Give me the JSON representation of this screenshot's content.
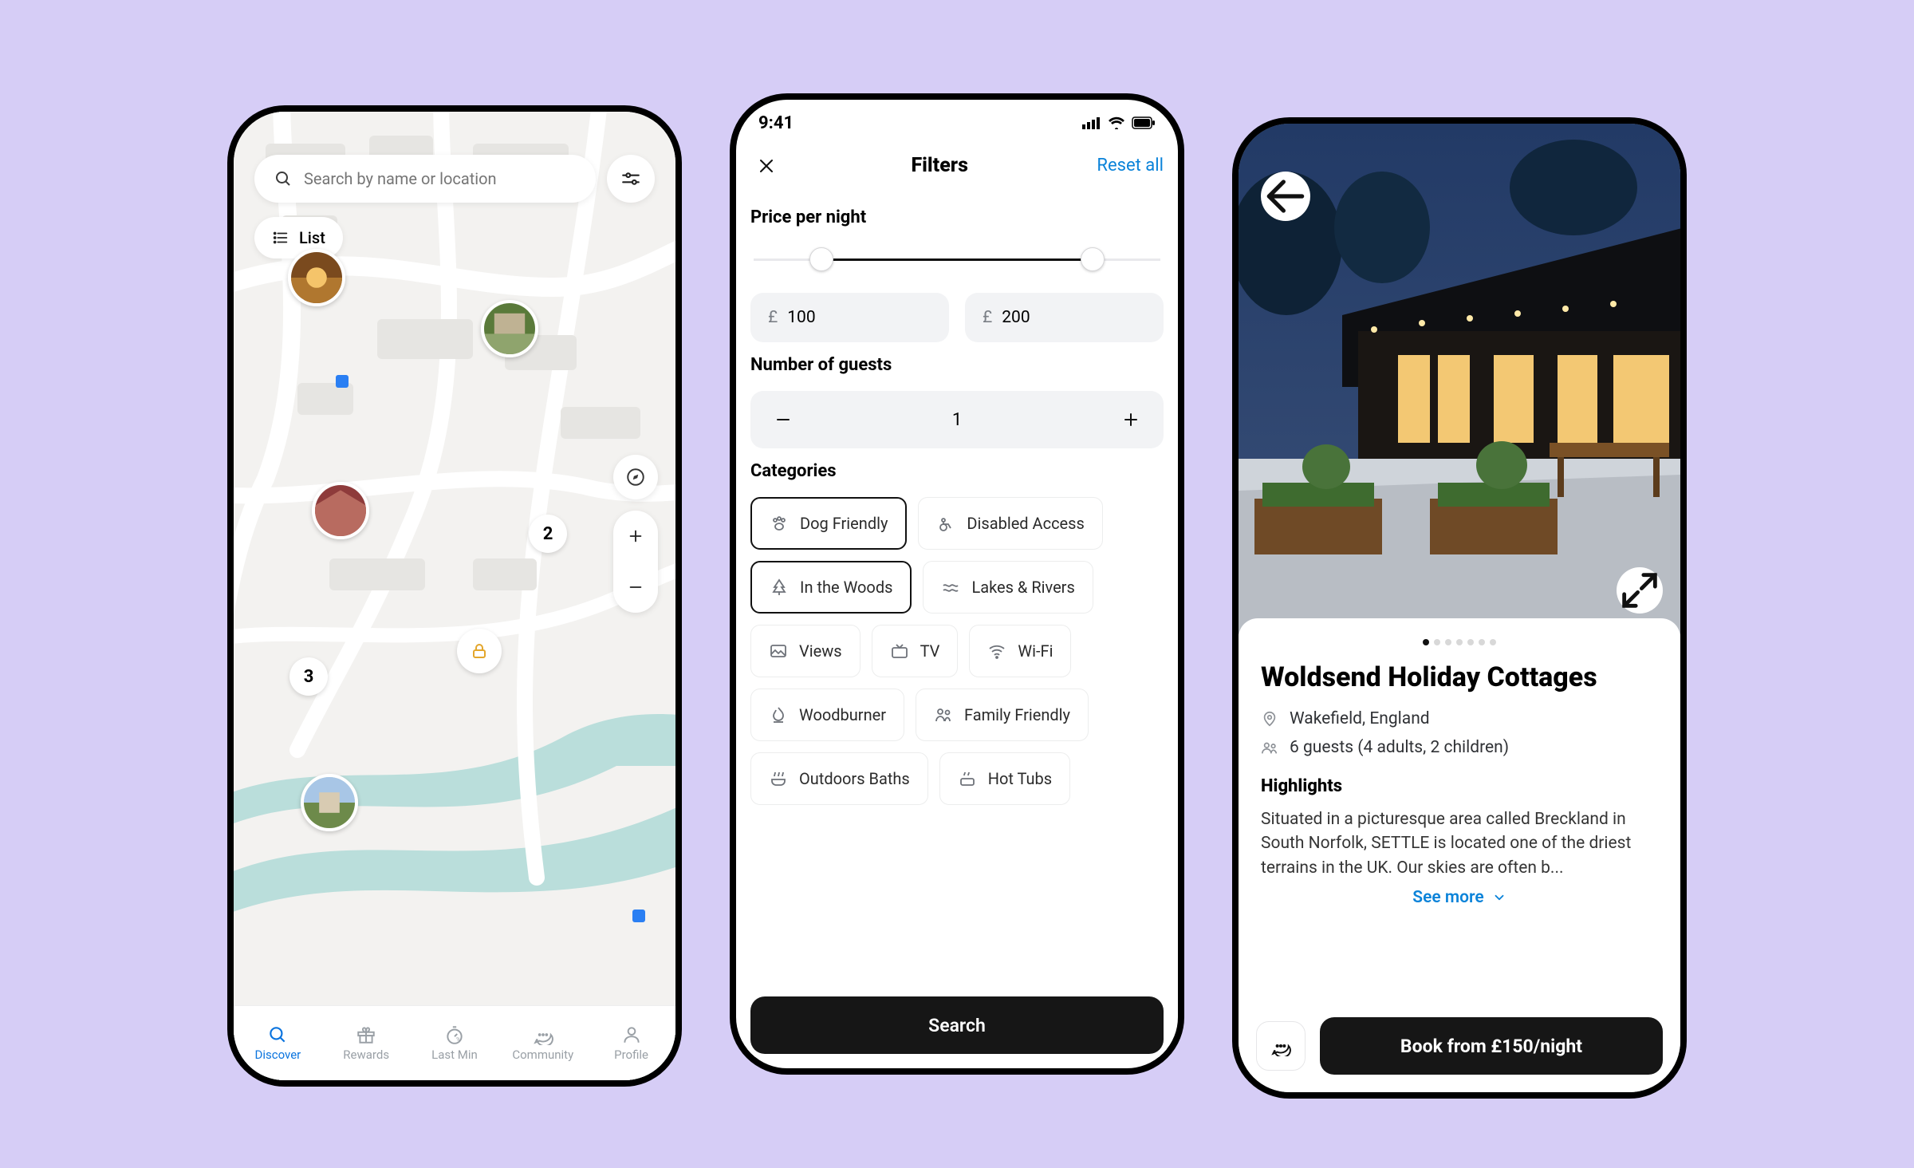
{
  "map": {
    "search_placeholder": "Search by name or location",
    "list_label": "List",
    "clusters": {
      "a": "2",
      "b": "3"
    },
    "tabs": {
      "discover": "Discover",
      "rewards": "Rewards",
      "lastmin": "Last Min",
      "community": "Community",
      "profile": "Profile"
    }
  },
  "filters": {
    "status_time": "9:41",
    "title": "Filters",
    "reset_label": "Reset all",
    "price_label": "Price per night",
    "currency": "£",
    "price_min": "100",
    "price_max": "200",
    "guests_label": "Number of guests",
    "guest_count": "1",
    "categories_label": "Categories",
    "cats": {
      "dog": "Dog Friendly",
      "disabled": "Disabled Access",
      "woods": "In the Woods",
      "lakes": "Lakes & Rivers",
      "views": "Views",
      "tv": "TV",
      "wifi": "Wi-Fi",
      "wood": "Woodburner",
      "family": "Family Friendly",
      "baths": "Outdoors Baths",
      "hottubs": "Hot Tubs"
    },
    "search_label": "Search"
  },
  "detail": {
    "title": "Woldsend Holiday Cottages",
    "location": "Wakefield, England",
    "guests": "6 guests (4 adults, 2 children)",
    "highlights_label": "Highlights",
    "highlights_text": "Situated in a picturesque area called Breckland in South Norfolk, SETTLE is located one of the driest terrains in the UK. Our skies are often b...",
    "see_more": "See more",
    "book_label": "Book from £150/night"
  }
}
